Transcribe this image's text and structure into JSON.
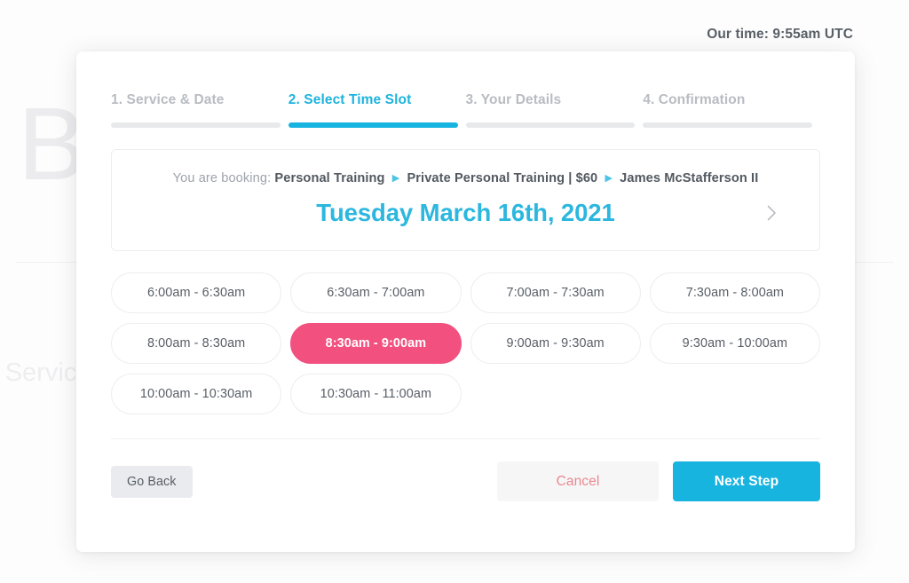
{
  "background": {
    "heading": "Book",
    "subheading": "r Service"
  },
  "clock": {
    "text": "Our time: 9:55am UTC"
  },
  "colors": {
    "accent_blue": "#18b4e0",
    "selected_pink": "#f2517f",
    "muted_grey": "#b9bcc2",
    "cancel_red": "#e9888e"
  },
  "steps": [
    {
      "label": "1. Service & Date",
      "active": false
    },
    {
      "label": "2. Select Time Slot",
      "active": true
    },
    {
      "label": "3. Your Details",
      "active": false
    },
    {
      "label": "4. Confirmation",
      "active": false
    }
  ],
  "summary": {
    "prefix": "You are booking:",
    "crumbs": [
      "Personal Training",
      "Private Personal Training | $60",
      "James McStafferson II"
    ],
    "separator": "▶",
    "date": "Tuesday March 16th, 2021",
    "next_date_icon": "chevron-right-icon"
  },
  "slots": [
    {
      "label": "6:00am - 6:30am",
      "selected": false
    },
    {
      "label": "6:30am - 7:00am",
      "selected": false
    },
    {
      "label": "7:00am - 7:30am",
      "selected": false
    },
    {
      "label": "7:30am - 8:00am",
      "selected": false
    },
    {
      "label": "8:00am - 8:30am",
      "selected": false
    },
    {
      "label": "8:30am - 9:00am",
      "selected": true
    },
    {
      "label": "9:00am - 9:30am",
      "selected": false
    },
    {
      "label": "9:30am - 10:00am",
      "selected": false
    },
    {
      "label": "10:00am - 10:30am",
      "selected": false
    },
    {
      "label": "10:30am - 11:00am",
      "selected": false
    }
  ],
  "footer": {
    "go_back_label": "Go Back",
    "cancel_label": "Cancel",
    "next_step_label": "Next Step"
  }
}
